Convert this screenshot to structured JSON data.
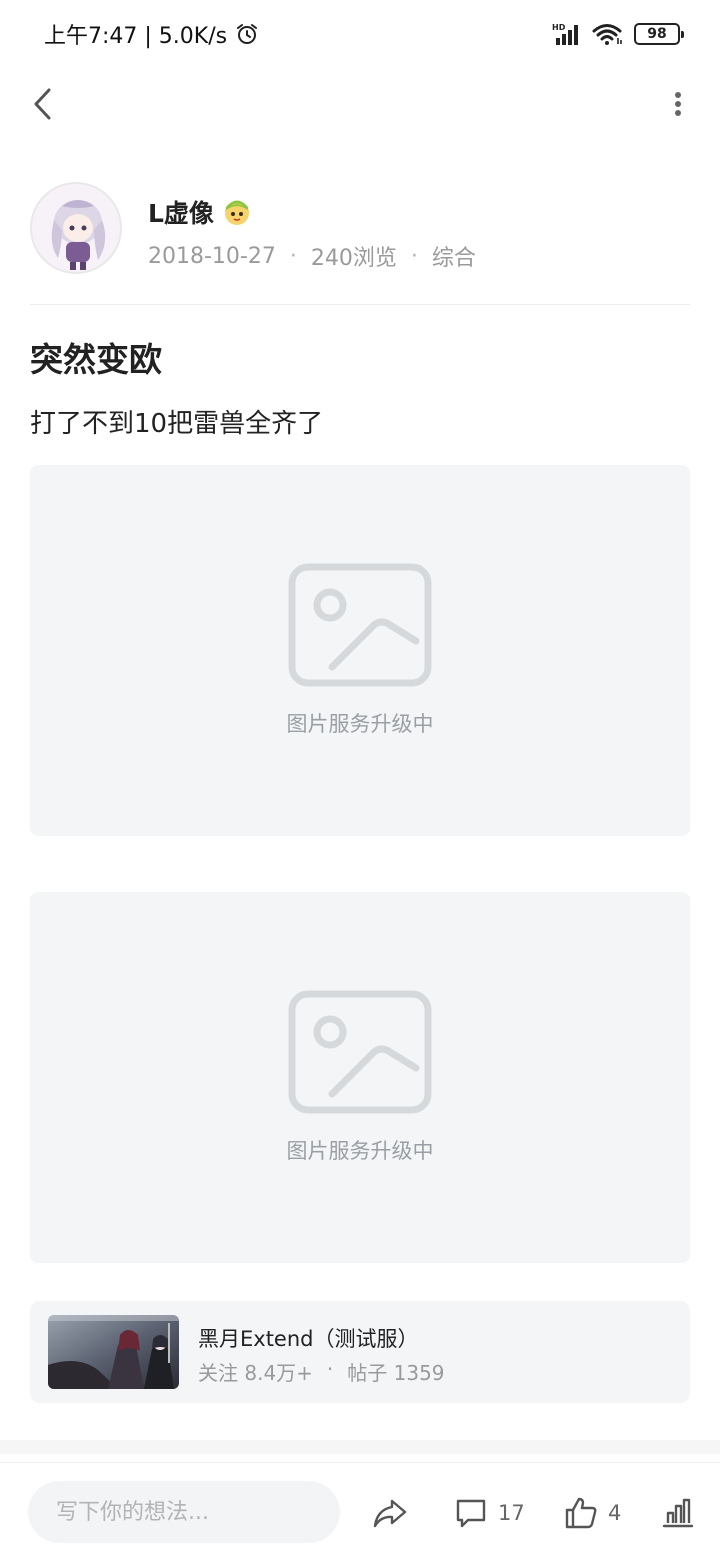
{
  "status_bar": {
    "time_speed": "上午7:47 | 5.0K/s",
    "battery": "98",
    "signal_label": "HD"
  },
  "author": {
    "name": "L虚像",
    "date": "2018-10-27",
    "views": "240浏览",
    "category": "综合"
  },
  "post": {
    "title": "突然变欧",
    "body": "打了不到10把雷兽全齐了",
    "images": [
      {
        "placeholder_text": "图片服务升级中"
      },
      {
        "placeholder_text": "图片服务升级中"
      }
    ]
  },
  "game": {
    "name": "黑月Extend（测试服）",
    "followers": "关注 8.4万+",
    "posts": "帖子 1359"
  },
  "bottom_bar": {
    "input_placeholder": "写下你的想法...",
    "comment_count": "17",
    "like_count": "4"
  },
  "colors": {
    "accent_text": "#222222",
    "muted_text": "#9a9a9a",
    "placeholder_bg": "#f4f5f7",
    "placeholder_icon": "#d6d9dc"
  }
}
